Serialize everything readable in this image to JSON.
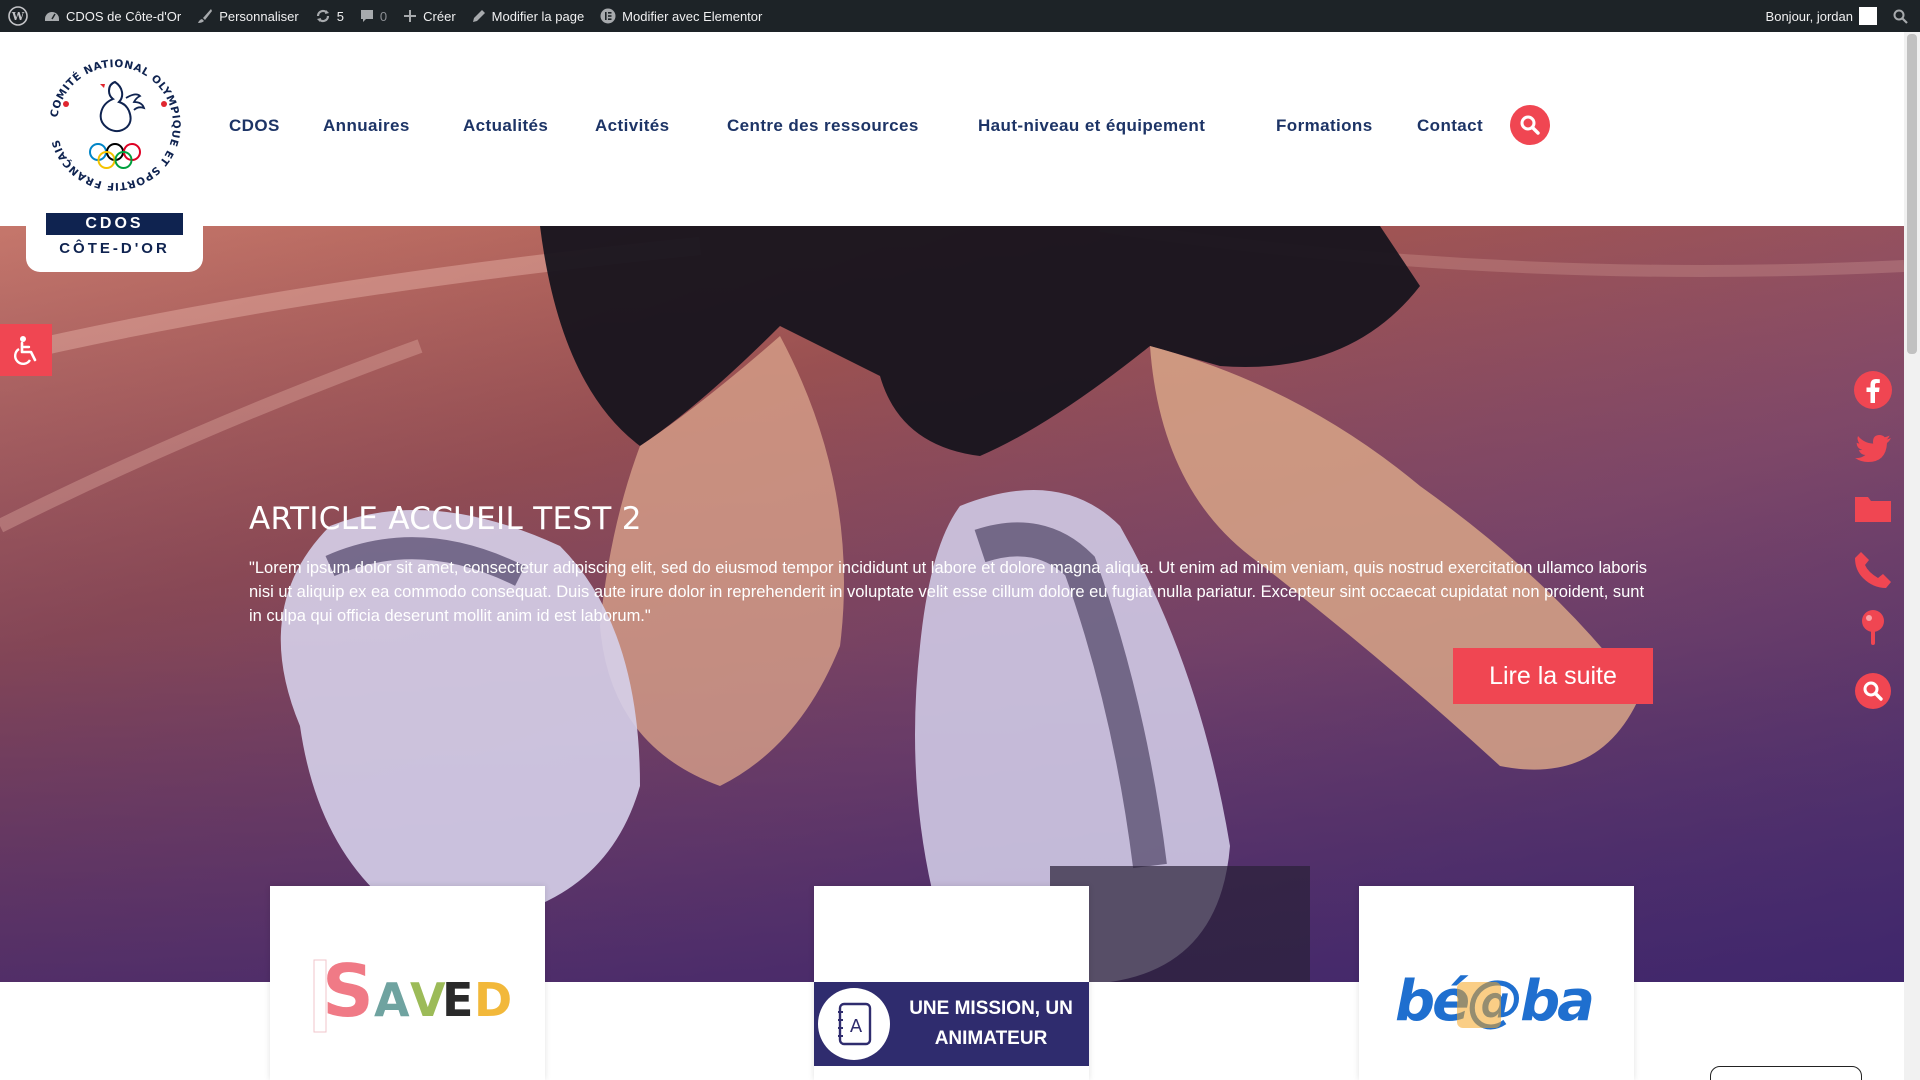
{
  "adminbar": {
    "site": "CDOS de Côte-d'Or",
    "customize": "Personnaliser",
    "updates_count": "5",
    "comments_count": "0",
    "create": "Créer",
    "edit_page": "Modifier la page",
    "edit_elementor": "Modifier avec Elementor",
    "greeting": "Bonjour, jordan"
  },
  "logo": {
    "ring_text": "COMITÉ NATIONAL OLYMPIQUE ET SPORTIF FRANÇAIS",
    "band": "CDOS",
    "subtitle": "CÔTE-D'OR"
  },
  "nav": {
    "items": [
      "CDOS",
      "Annuaires",
      "Actualités",
      "Activités",
      "Centre des ressources",
      "Haut-niveau et équipement",
      "Formations",
      "Contact"
    ],
    "search_icon": "search-icon"
  },
  "hero": {
    "title": "ARTICLE ACCUEIL TEST 2",
    "text": "\"Lorem ipsum dolor sit amet, consectetur adipiscing elit, sed do eiusmod tempor incididunt ut labore et dolore magna aliqua. Ut enim ad minim veniam, quis nostrud exercitation ullamco laboris nisi ut aliquip ex ea commodo consequat. Duis aute irure dolor in reprehenderit in voluptate velit esse cillum dolore eu fugiat nulla pariatur. Excepteur sint occaecat cupidatat non proident, sunt in culpa qui officia deserunt mollit anim id est laborum.\"",
    "button": "Lire la suite"
  },
  "social": [
    "facebook-icon",
    "twitter-icon",
    "folder-icon",
    "phone-icon",
    "map-pin-icon",
    "search-icon"
  ],
  "cards": {
    "card1_logo": "SAVED",
    "card2_badge": "A",
    "card2_text": "UNE MISSION, UN ANIMATEUR",
    "card3_logo": "bé@ba"
  },
  "colors": {
    "accent": "#f04652",
    "navy": "#1d3466",
    "adminbar": "#1d2327",
    "mission_banner": "#2f2c6e"
  }
}
